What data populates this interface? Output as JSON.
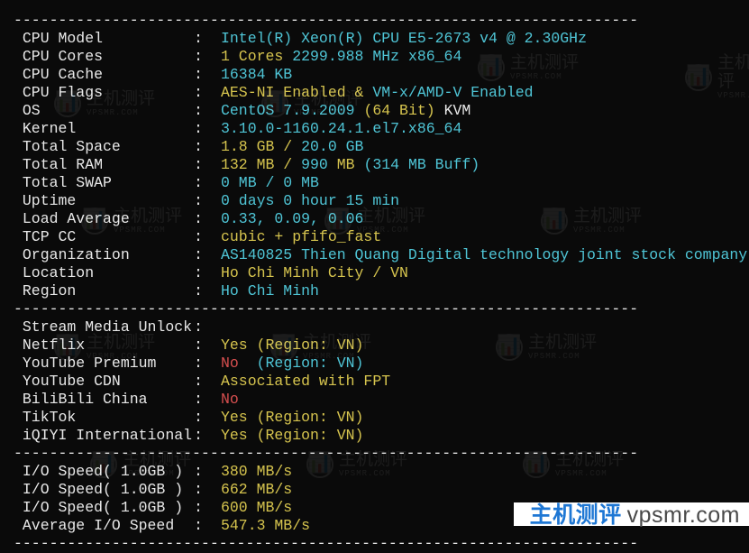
{
  "dash": "----------------------------------------------------------------------",
  "sysinfo": [
    {
      "label": " CPU Model",
      "parts": [
        {
          "cls": "cyan",
          "text": "Intel(R) Xeon(R) CPU E5-2673 v4 @ 2.30GHz"
        }
      ]
    },
    {
      "label": " CPU Cores",
      "parts": [
        {
          "cls": "yellow",
          "text": "1 Cores "
        },
        {
          "cls": "cyan",
          "text": "2299.988 MHz x86_64"
        }
      ]
    },
    {
      "label": " CPU Cache",
      "parts": [
        {
          "cls": "cyan",
          "text": "16384 KB"
        }
      ]
    },
    {
      "label": " CPU Flags",
      "parts": [
        {
          "cls": "yellow",
          "text": "AES-NI Enabled & "
        },
        {
          "cls": "cyan",
          "text": "VM-x/AMD-V Enabled"
        }
      ]
    },
    {
      "label": " OS",
      "parts": [
        {
          "cls": "cyan",
          "text": "CentOS 7.9.2009 "
        },
        {
          "cls": "yellow",
          "text": "(64 Bit) "
        },
        {
          "cls": "white",
          "text": "KVM"
        }
      ]
    },
    {
      "label": " Kernel",
      "parts": [
        {
          "cls": "cyan",
          "text": "3.10.0-1160.24.1.el7.x86_64"
        }
      ]
    },
    {
      "label": " Total Space",
      "parts": [
        {
          "cls": "yellow",
          "text": "1.8 GB / "
        },
        {
          "cls": "cyan",
          "text": "20.0 GB"
        }
      ]
    },
    {
      "label": " Total RAM",
      "parts": [
        {
          "cls": "yellow",
          "text": "132 MB / "
        },
        {
          "cls": "cyan",
          "text": "990 "
        },
        {
          "cls": "yellow",
          "text": "MB "
        },
        {
          "cls": "cyan",
          "text": "(314 MB Buff)"
        }
      ]
    },
    {
      "label": " Total SWAP",
      "parts": [
        {
          "cls": "cyan",
          "text": "0 MB / 0 MB"
        }
      ]
    },
    {
      "label": " Uptime",
      "parts": [
        {
          "cls": "cyan",
          "text": "0 days 0 hour 15 min"
        }
      ]
    },
    {
      "label": " Load Average",
      "parts": [
        {
          "cls": "cyan",
          "text": "0.33, 0.09, 0.06"
        }
      ]
    },
    {
      "label": " TCP CC",
      "parts": [
        {
          "cls": "yellow",
          "text": "cubic + pfifo_fast"
        }
      ]
    },
    {
      "label": " Organization",
      "parts": [
        {
          "cls": "cyan",
          "text": "AS140825 Thien Quang Digital technology joint stock company"
        }
      ]
    },
    {
      "label": " Location",
      "parts": [
        {
          "cls": "yellow",
          "text": "Ho Chi Minh City / VN"
        }
      ]
    },
    {
      "label": " Region",
      "parts": [
        {
          "cls": "cyan",
          "text": "Ho Chi Minh"
        }
      ]
    }
  ],
  "stream_header": {
    "label": " Stream Media Unlock",
    "parts": []
  },
  "stream": [
    {
      "label": " Netflix",
      "parts": [
        {
          "cls": "yellow",
          "text": "Yes (Region: VN)"
        }
      ]
    },
    {
      "label": " YouTube Premium",
      "parts": [
        {
          "cls": "red",
          "text": "No "
        },
        {
          "cls": "cyan",
          "text": " (Region: VN)"
        }
      ]
    },
    {
      "label": " YouTube CDN",
      "parts": [
        {
          "cls": "yellow",
          "text": "Associated with FPT"
        }
      ]
    },
    {
      "label": " BiliBili China",
      "parts": [
        {
          "cls": "red",
          "text": "No"
        }
      ]
    },
    {
      "label": " TikTok",
      "parts": [
        {
          "cls": "yellow",
          "text": "Yes (Region: VN)"
        }
      ]
    },
    {
      "label": " iQIYI International",
      "parts": [
        {
          "cls": "yellow",
          "text": "Yes (Region: VN)"
        }
      ]
    }
  ],
  "io": [
    {
      "label": " I/O Speed( 1.0GB )",
      "parts": [
        {
          "cls": "yellow",
          "text": "380 MB/s"
        }
      ]
    },
    {
      "label": " I/O Speed( 1.0GB )",
      "parts": [
        {
          "cls": "yellow",
          "text": "662 MB/s"
        }
      ]
    },
    {
      "label": " I/O Speed( 1.0GB )",
      "parts": [
        {
          "cls": "yellow",
          "text": "600 MB/s"
        }
      ]
    },
    {
      "label": " Average I/O Speed",
      "parts": [
        {
          "cls": "yellow",
          "text": "547.3 MB/s"
        }
      ]
    }
  ],
  "footer": {
    "title": "主机测评",
    "domain": "vpsmr.com"
  },
  "watermark": {
    "text": "主机测评",
    "sub": "VPSMR.COM"
  }
}
